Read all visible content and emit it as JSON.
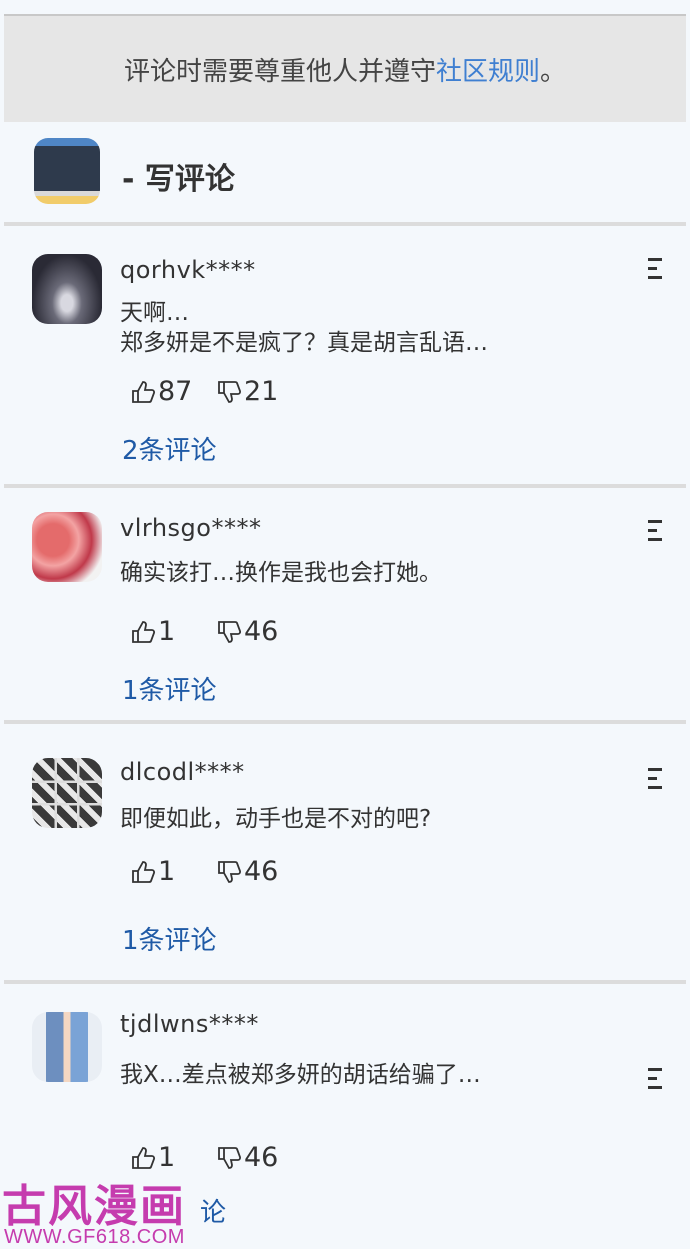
{
  "notice": {
    "text_before": "评论时需要尊重他人并遵守",
    "link_text": "社区规则",
    "text_after": "。"
  },
  "compose": {
    "label": "- 写评论"
  },
  "comments": [
    {
      "username": "qorhvk****",
      "lines": [
        "天啊…",
        "郑多妍是不是疯了？真是胡言乱语…"
      ],
      "likes": "87",
      "dislikes": "21",
      "replies": "2条评论"
    },
    {
      "username": "vlrhsgo****",
      "lines": [
        "确实该打…换作是我也会打她。"
      ],
      "likes": "1",
      "dislikes": "46",
      "replies": "1条评论"
    },
    {
      "username": "dlcodl****",
      "lines": [
        "即便如此，动手也是不对的吧?"
      ],
      "likes": "1",
      "dislikes": "46",
      "replies": "1条评论"
    },
    {
      "username": "tjdlwns****",
      "lines": [
        "我X…差点被郑多妍的胡话给骗了…"
      ],
      "likes": "1",
      "dislikes": "46",
      "replies": "论"
    }
  ],
  "watermark": {
    "logo": "古风漫画网",
    "url": "WWW.GF618.COM"
  },
  "colors": {
    "link": "#3f7fd1",
    "reply": "#1f5aa6",
    "watermark": "#c53cae"
  }
}
